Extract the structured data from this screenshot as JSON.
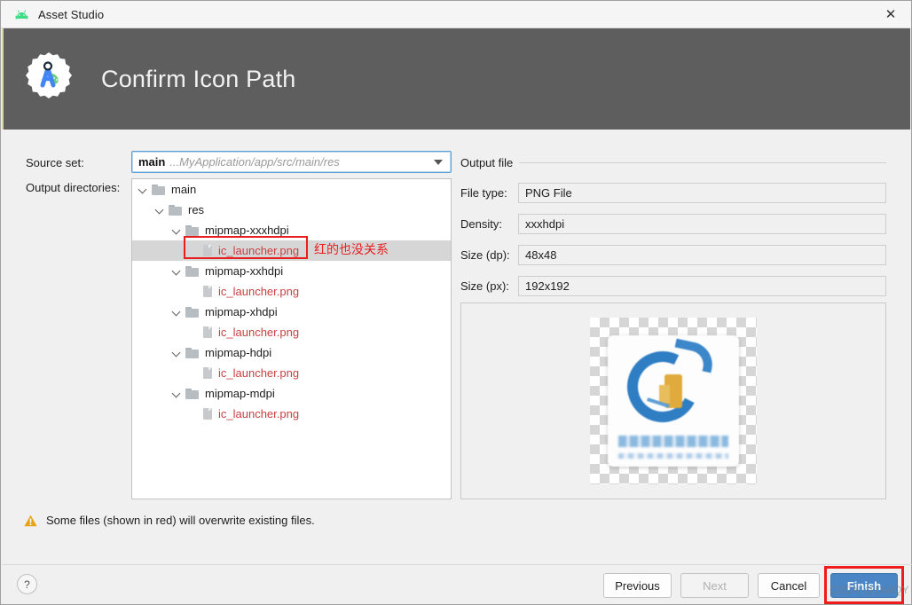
{
  "titlebar": {
    "app_icon": "android-icon",
    "title": "Asset Studio",
    "close_label": "✕"
  },
  "banner": {
    "icon": "asset-studio-icon",
    "title": "Confirm Icon Path"
  },
  "source_set": {
    "label": "Source set:",
    "value_main": "main",
    "value_path": "...MyApplication/app/src/main/res"
  },
  "output_directories": {
    "label": "Output directories:",
    "tree": [
      {
        "depth": 0,
        "type": "folder",
        "name": "main",
        "expanded": true,
        "red": false,
        "selected": false
      },
      {
        "depth": 1,
        "type": "folder",
        "name": "res",
        "expanded": true,
        "red": false,
        "selected": false
      },
      {
        "depth": 2,
        "type": "folder",
        "name": "mipmap-xxxhdpi",
        "expanded": true,
        "red": false,
        "selected": false
      },
      {
        "depth": 3,
        "type": "file",
        "name": "ic_launcher.png",
        "expanded": false,
        "red": true,
        "selected": true
      },
      {
        "depth": 2,
        "type": "folder",
        "name": "mipmap-xxhdpi",
        "expanded": true,
        "red": false,
        "selected": false
      },
      {
        "depth": 3,
        "type": "file",
        "name": "ic_launcher.png",
        "expanded": false,
        "red": true,
        "selected": false
      },
      {
        "depth": 2,
        "type": "folder",
        "name": "mipmap-xhdpi",
        "expanded": true,
        "red": false,
        "selected": false
      },
      {
        "depth": 3,
        "type": "file",
        "name": "ic_launcher.png",
        "expanded": false,
        "red": true,
        "selected": false
      },
      {
        "depth": 2,
        "type": "folder",
        "name": "mipmap-hdpi",
        "expanded": true,
        "red": false,
        "selected": false
      },
      {
        "depth": 3,
        "type": "file",
        "name": "ic_launcher.png",
        "expanded": false,
        "red": true,
        "selected": false
      },
      {
        "depth": 2,
        "type": "folder",
        "name": "mipmap-mdpi",
        "expanded": true,
        "red": false,
        "selected": false
      },
      {
        "depth": 3,
        "type": "file",
        "name": "ic_launcher.png",
        "expanded": false,
        "red": true,
        "selected": false
      }
    ]
  },
  "annotations": {
    "tree_note": "红的也没关系",
    "note_color": "#e81f1f",
    "finish_highlight_color": "#ee1c1c"
  },
  "output_file": {
    "legend": "Output file",
    "fields": [
      {
        "label": "File type:",
        "value": "PNG File"
      },
      {
        "label": "Density:",
        "value": "xxxhdpi"
      },
      {
        "label": "Size (dp):",
        "value": "48x48"
      },
      {
        "label": "Size (px):",
        "value": "192x192"
      }
    ],
    "preview_icon": "launcher-icon-preview"
  },
  "warning": {
    "icon": "warning-triangle-icon",
    "text": "Some files (shown in red) will overwrite existing files.",
    "color": "#e8a317"
  },
  "footer": {
    "help_label": "?",
    "previous": "Previous",
    "next": "Next",
    "cancel": "Cancel",
    "finish": "Finish",
    "next_enabled": false,
    "accent_color": "#4a86c5"
  },
  "watermark": {
    "text": "CSDN @DWQY"
  }
}
